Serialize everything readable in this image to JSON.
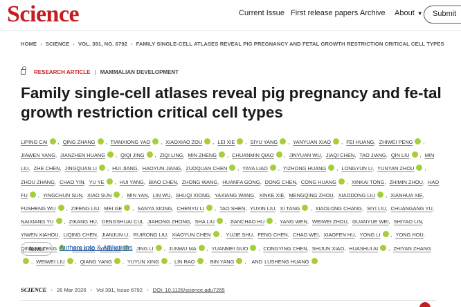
{
  "header": {
    "logo": "Science",
    "nav": [
      "Current Issue",
      "First release papers",
      "Archive",
      "About"
    ],
    "submit_label": "Submit"
  },
  "breadcrumb": [
    "HOME",
    "SCIENCE",
    "VOL. 391, NO. 6792",
    "FAMILY SINGLE-CELL ATLASES REVEAL PIG PREGNANCY AND FETAL GROWTH RESTRICTION CRITICAL CELL TYPES"
  ],
  "article": {
    "type": "RESEARCH ARTICLE",
    "subject": "MAMMALIAN DEVELOPMENT",
    "title": "Family single-cell atlases reveal pig pregnancy and fe-tal growth restriction critical cell types"
  },
  "authors": [
    {
      "name": "LIPING CAI",
      "orcid": true
    },
    {
      "name": "QING ZHANG",
      "orcid": true
    },
    {
      "name": "TIANXIONG YAO",
      "orcid": true
    },
    {
      "name": "XIAOXIAO ZOU",
      "orcid": true
    },
    {
      "name": "LEI XIE",
      "orcid": true
    },
    {
      "name": "SIYU YANG",
      "orcid": true
    },
    {
      "name": "YANYUAN XIAO",
      "orcid": true
    },
    {
      "name": "FEI HUANG",
      "orcid": false
    },
    {
      "name": "ZHIWEI PENG",
      "orcid": true
    },
    {
      "name": "JIAWEN YANG",
      "orcid": false
    },
    {
      "name": "JIANZHEN HUANG",
      "orcid": true
    },
    {
      "name": "QIQI JING",
      "orcid": true
    },
    {
      "name": "ZIQI LING",
      "orcid": false
    },
    {
      "name": "MIN ZHENG",
      "orcid": true
    },
    {
      "name": "CHUANMIN QIAO",
      "orcid": true
    },
    {
      "name": "JINYUAN WU",
      "orcid": false
    },
    {
      "name": "JIAQI CHEN",
      "orcid": false
    },
    {
      "name": "TAO JIANG",
      "orcid": false
    },
    {
      "name": "QIN LIU",
      "orcid": true
    },
    {
      "name": "MIN LIU",
      "orcid": false
    },
    {
      "name": "ZHE CHEN",
      "orcid": false
    },
    {
      "name": "JINGQUAN LI",
      "orcid": true
    },
    {
      "name": "HUI JIANG",
      "orcid": false
    },
    {
      "name": "HAOYUN JIANG",
      "orcid": false
    },
    {
      "name": "ZUOQUAN CHEN",
      "orcid": true
    },
    {
      "name": "YAYA LIAO",
      "orcid": true
    },
    {
      "name": "YIZHONG HUANG",
      "orcid": true
    },
    {
      "name": "LONGYUN LI",
      "orcid": false
    },
    {
      "name": "YUNYAN ZHOU",
      "orcid": true
    },
    {
      "name": "ZHOU ZHANG",
      "orcid": false
    },
    {
      "name": "CHAO YIN",
      "orcid": false
    },
    {
      "name": "YU YE",
      "orcid": true
    },
    {
      "name": "HUI YANG",
      "orcid": false
    },
    {
      "name": "BIAO CHEN",
      "orcid": false
    },
    {
      "name": "ZHONG WANG",
      "orcid": false
    },
    {
      "name": "HUANFA GONG",
      "orcid": false
    },
    {
      "name": "DONG CHEN",
      "orcid": false
    },
    {
      "name": "CONG HUANG",
      "orcid": true
    },
    {
      "name": "XINKAI TONG",
      "orcid": false
    },
    {
      "name": "ZHIMIN ZHOU",
      "orcid": false
    },
    {
      "name": "HAO FU",
      "orcid": true
    },
    {
      "name": "YINGCHUN SUN",
      "orcid": false
    },
    {
      "name": "XIAO SUN",
      "orcid": true
    },
    {
      "name": "MIN YAN",
      "orcid": false
    },
    {
      "name": "LIN WU",
      "orcid": false
    },
    {
      "name": "SHUQI XIONG",
      "orcid": false
    },
    {
      "name": "YAXIANG WANG",
      "orcid": false
    },
    {
      "name": "XINKE XIE",
      "orcid": false
    },
    {
      "name": "MENGQING ZHOU",
      "orcid": false
    },
    {
      "name": "XIAODONG LIU",
      "orcid": true
    },
    {
      "name": "XIANHUA XIE",
      "orcid": false
    },
    {
      "name": "FUSHENG WU",
      "orcid": true
    },
    {
      "name": "ZIFENG LIU",
      "orcid": false
    },
    {
      "name": "MEI GE",
      "orcid": true
    },
    {
      "name": "SANYA XIONG",
      "orcid": false
    },
    {
      "name": "CHENYU LI",
      "orcid": true
    },
    {
      "name": "TAO SHEN",
      "orcid": false
    },
    {
      "name": "YUXIN LIU",
      "orcid": false
    },
    {
      "name": "XI TANG",
      "orcid": true
    },
    {
      "name": "XIAOLONG CHANG",
      "orcid": false
    },
    {
      "name": "SIYI LIU",
      "orcid": false
    },
    {
      "name": "CHUANGANG YU",
      "orcid": false
    },
    {
      "name": "NAIXIANG YU",
      "orcid": true
    },
    {
      "name": "ZIKANG HU",
      "orcid": false
    },
    {
      "name": "DENGSHUAI CUI",
      "orcid": false
    },
    {
      "name": "JIAHONG ZHONG",
      "orcid": false
    },
    {
      "name": "SHA LIU",
      "orcid": true
    },
    {
      "name": "JIANCHAO HU",
      "orcid": true
    },
    {
      "name": "YANG WEN",
      "orcid": false
    },
    {
      "name": "WEIWEI ZHOU",
      "orcid": false
    },
    {
      "name": "GUANYUE WEI",
      "orcid": false
    },
    {
      "name": "SHIYAO LIN",
      "orcid": false
    },
    {
      "name": "YIWEN XIAHOU",
      "orcid": false
    },
    {
      "name": "LIQING CHEN",
      "orcid": false
    },
    {
      "name": "JIANJUN LI",
      "orcid": false
    },
    {
      "name": "RUIRONG LIU",
      "orcid": false
    },
    {
      "name": "XIAOYUN CHEN",
      "orcid": true
    },
    {
      "name": "YUJIE SHU",
      "orcid": false
    },
    {
      "name": "FENG CHEN",
      "orcid": false
    },
    {
      "name": "CHAO WEI",
      "orcid": false
    },
    {
      "name": "XIAOFEN HU",
      "orcid": false
    },
    {
      "name": "YONG LI",
      "orcid": true
    },
    {
      "name": "YONG HOU",
      "orcid": false
    },
    {
      "name": "QINGJIE ZENG",
      "orcid": true
    },
    {
      "name": "JUN GAO",
      "orcid": false
    },
    {
      "name": "YING SU",
      "orcid": true
    },
    {
      "name": "JING LI",
      "orcid": true
    },
    {
      "name": "JUNWU MA",
      "orcid": true
    },
    {
      "name": "YUANMEI GUO",
      "orcid": true
    },
    {
      "name": "CONGYING CHEN",
      "orcid": false
    },
    {
      "name": "SHIJUN XIAO",
      "orcid": false
    },
    {
      "name": "HUASHUI AI",
      "orcid": true
    },
    {
      "name": "ZHIYAN ZHANG",
      "orcid": true
    },
    {
      "name": "WEIWEI LIU",
      "orcid": true
    },
    {
      "name": "QIANG YANG",
      "orcid": true
    },
    {
      "name": "YUYUN XING",
      "orcid": true
    },
    {
      "name": "LIN RAO",
      "orcid": true
    },
    {
      "name": "BIN YANG",
      "orcid": true
    },
    {
      "name": "LUSHENG HUANG",
      "orcid": true
    }
  ],
  "authors_and": "AND",
  "authors_controls": {
    "fewer_label": "fewer",
    "info_label": "Authors Info & Affiliations"
  },
  "meta": {
    "journal": "SCIENCE",
    "date": "26 Mar 2026",
    "issue": "Vol 391, Issue 6792",
    "doi": "DOI: 10.1126/science.adu7265"
  },
  "icons": {
    "lock": "lock-icon",
    "orcid": "orcid-icon",
    "caret": "chevron-down-icon"
  },
  "colors": {
    "brand_red": "#c41e24",
    "orcid_green": "#a6ce39",
    "link_blue": "#1f5fb0"
  }
}
